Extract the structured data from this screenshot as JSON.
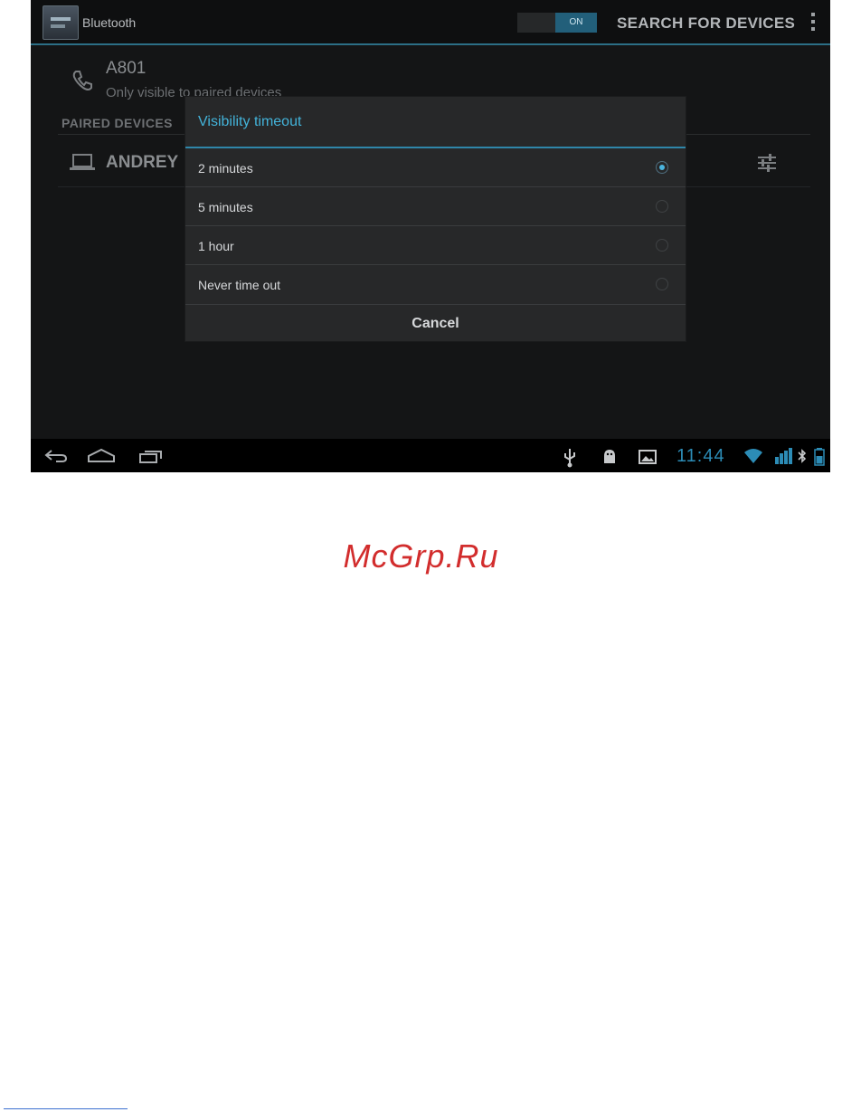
{
  "action_bar": {
    "title": "Bluetooth",
    "toggle_label": "ON",
    "search_label": "SEARCH FOR DEVICES"
  },
  "device": {
    "name": "A801",
    "visibility_text": "Only visible to paired devices"
  },
  "paired": {
    "header": "PAIRED DEVICES",
    "device_name": "ANDREY"
  },
  "dialog": {
    "title": "Visibility timeout",
    "options": [
      {
        "label": "2 minutes",
        "selected": true
      },
      {
        "label": "5 minutes",
        "selected": false
      },
      {
        "label": "1 hour",
        "selected": false
      },
      {
        "label": "Never time out",
        "selected": false
      }
    ],
    "cancel_label": "Cancel"
  },
  "status_bar": {
    "time": "11:44"
  },
  "watermark": "McGrp.Ru",
  "colors": {
    "accent": "#43b3d9",
    "background": "#141516",
    "dialog": "#272829"
  }
}
